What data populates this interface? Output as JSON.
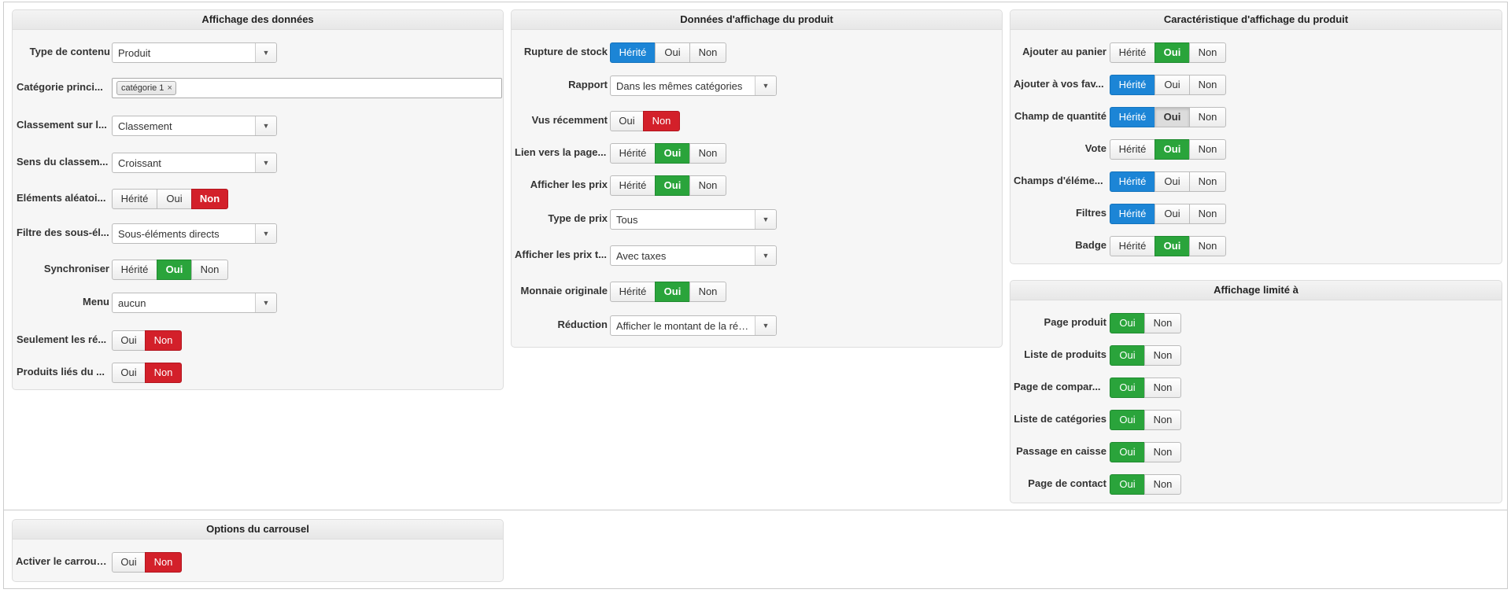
{
  "data_display": {
    "title": "Affichage des données",
    "content_type": {
      "label": "Type de contenu",
      "value": "Produit"
    },
    "main_category": {
      "label": "Catégorie princi...",
      "tag": "catégorie 1",
      "remove": "×"
    },
    "sort_on": {
      "label": "Classement sur l...",
      "value": "Classement"
    },
    "sort_direction": {
      "label": "Sens du classem...",
      "value": "Croissant"
    },
    "random_items": {
      "label": "Eléments aléatoi...",
      "opt1": "Hérité",
      "opt2": "Oui",
      "opt3": "Non",
      "selected": "Non"
    },
    "sub_filter": {
      "label": "Filtre des sous-él...",
      "value": "Sous-éléments directs"
    },
    "synchronize": {
      "label": "Synchroniser",
      "opt1": "Hérité",
      "opt2": "Oui",
      "opt3": "Non",
      "selected": "Oui"
    },
    "menu": {
      "label": "Menu",
      "value": "aucun"
    },
    "only_reduced": {
      "label": "Seulement les ré...",
      "opt1": "Oui",
      "opt2": "Non",
      "selected": "Non"
    },
    "linked_products": {
      "label": "Produits liés du ...",
      "opt1": "Oui",
      "opt2": "Non",
      "selected": "Non"
    }
  },
  "product_display": {
    "title": "Données d'affichage du produit",
    "out_of_stock": {
      "label": "Rupture de stock",
      "opt1": "Hérité",
      "opt2": "Oui",
      "opt3": "Non",
      "selected": "Hérité"
    },
    "report": {
      "label": "Rapport",
      "value": "Dans les mêmes catégories"
    },
    "recently_viewed": {
      "label": "Vus récemment",
      "opt1": "Oui",
      "opt2": "Non",
      "selected": "Non"
    },
    "page_link": {
      "label": "Lien vers la page...",
      "opt1": "Hérité",
      "opt2": "Oui",
      "opt3": "Non",
      "selected": "Oui"
    },
    "show_prices": {
      "label": "Afficher les prix",
      "opt1": "Hérité",
      "opt2": "Oui",
      "opt3": "Non",
      "selected": "Oui"
    },
    "price_type": {
      "label": "Type de prix",
      "value": "Tous"
    },
    "show_prices_tax": {
      "label": "Afficher les prix t...",
      "value": "Avec taxes"
    },
    "original_currency": {
      "label": "Monnaie originale",
      "opt1": "Hérité",
      "opt2": "Oui",
      "opt3": "Non",
      "selected": "Oui"
    },
    "discount": {
      "label": "Réduction",
      "value": "Afficher le montant de la réd..."
    }
  },
  "product_features": {
    "title": "Caractéristique d'affichage du produit",
    "add_to_cart": {
      "label": "Ajouter au panier",
      "opt1": "Hérité",
      "opt2": "Oui",
      "opt3": "Non",
      "selected": "Oui"
    },
    "add_to_favorites": {
      "label": "Ajouter à vos fav...",
      "opt1": "Hérité",
      "opt2": "Oui",
      "opt3": "Non",
      "selected": "Hérité"
    },
    "quantity_field": {
      "label": "Champ de quantité",
      "opt1": "Hérité",
      "opt2": "Oui",
      "opt3": "Non",
      "selected": "Hérité",
      "pressed": "Oui"
    },
    "vote": {
      "label": "Vote",
      "opt1": "Hérité",
      "opt2": "Oui",
      "opt3": "Non",
      "selected": "Oui"
    },
    "item_fields": {
      "label": "Champs d'éléme...",
      "opt1": "Hérité",
      "opt2": "Oui",
      "opt3": "Non",
      "selected": "Hérité"
    },
    "filters": {
      "label": "Filtres",
      "opt1": "Hérité",
      "opt2": "Oui",
      "opt3": "Non",
      "selected": "Hérité"
    },
    "badge": {
      "label": "Badge",
      "opt1": "Hérité",
      "opt2": "Oui",
      "opt3": "Non",
      "selected": "Oui"
    }
  },
  "limited_display": {
    "title": "Affichage limité à",
    "product_page": {
      "label": "Page produit",
      "opt1": "Oui",
      "opt2": "Non",
      "selected": "Oui"
    },
    "product_list": {
      "label": "Liste de produits",
      "opt1": "Oui",
      "opt2": "Non",
      "selected": "Oui"
    },
    "compare_page": {
      "label": "Page de compar...",
      "opt1": "Oui",
      "opt2": "Non",
      "selected": "Oui"
    },
    "category_list": {
      "label": "Liste de catégories",
      "opt1": "Oui",
      "opt2": "Non",
      "selected": "Oui"
    },
    "checkout": {
      "label": "Passage en caisse",
      "opt1": "Oui",
      "opt2": "Non",
      "selected": "Oui"
    },
    "contact_page": {
      "label": "Page de contact",
      "opt1": "Oui",
      "opt2": "Non",
      "selected": "Oui"
    }
  },
  "carousel": {
    "title": "Options du carrousel",
    "enable": {
      "label": "Activer le carrousel",
      "opt1": "Oui",
      "opt2": "Non",
      "selected": "Non"
    }
  },
  "colors": {
    "inherited_active": "#1c85d6",
    "yes_active": "#2aa43b",
    "no_active": "#d3202a"
  }
}
